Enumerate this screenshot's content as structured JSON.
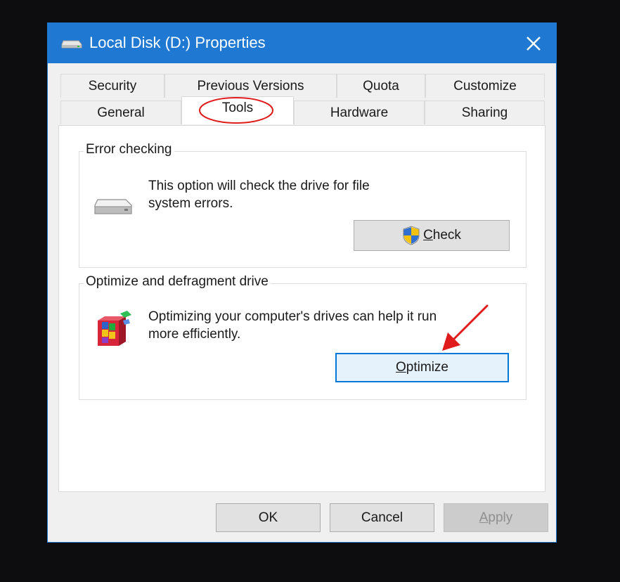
{
  "window": {
    "title": "Local Disk (D:) Properties"
  },
  "tabs": {
    "row1": [
      "Security",
      "Previous Versions",
      "Quota",
      "Customize"
    ],
    "row2": [
      "General",
      "Tools",
      "Hardware",
      "Sharing"
    ],
    "active": "Tools"
  },
  "error_checking": {
    "title": "Error checking",
    "description_line1": "This option will check the drive for file",
    "description_line2": "system errors.",
    "button_label": "Check"
  },
  "optimize": {
    "title": "Optimize and defragment drive",
    "description_line1": "Optimizing your computer's drives can help it run",
    "description_line2": "more efficiently.",
    "button_label": "Optimize"
  },
  "footer": {
    "ok_label": "OK",
    "cancel_label": "Cancel",
    "apply_label": "Apply"
  },
  "colors": {
    "titlebar": "#1f78d1",
    "annotation": "#e01b1b"
  }
}
